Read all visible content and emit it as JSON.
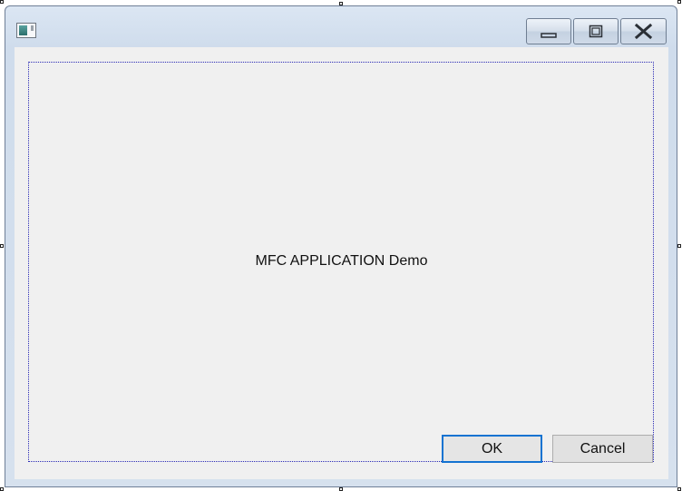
{
  "window": {
    "title": "",
    "icon": "dialog-app-icon"
  },
  "caption_buttons": {
    "minimize": "minimize-icon",
    "maximize": "maximize-icon",
    "close": "close-icon"
  },
  "dialog": {
    "static_text": "MFC APPLICATION Demo",
    "ok_label": "OK",
    "cancel_label": "Cancel"
  },
  "colors": {
    "frame": "#d6e1ee",
    "client": "#f0f0f0",
    "default_button_border": "#1473d1",
    "guide": "#2b2bb6"
  }
}
